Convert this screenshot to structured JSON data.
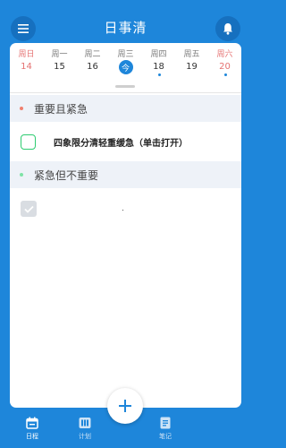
{
  "header": {
    "title": "日事清",
    "menu_icon": "menu-icon",
    "bell_icon": "bell-icon"
  },
  "week": [
    {
      "name": "周日",
      "date": "14",
      "weekend": true,
      "today": false,
      "has_event": false
    },
    {
      "name": "周一",
      "date": "15",
      "weekend": false,
      "today": false,
      "has_event": false
    },
    {
      "name": "周二",
      "date": "16",
      "weekend": false,
      "today": false,
      "has_event": false
    },
    {
      "name": "周三",
      "date": "今",
      "weekend": false,
      "today": true,
      "has_event": false
    },
    {
      "name": "周四",
      "date": "18",
      "weekend": false,
      "today": false,
      "has_event": true
    },
    {
      "name": "周五",
      "date": "19",
      "weekend": false,
      "today": false,
      "has_event": false
    },
    {
      "name": "周六",
      "date": "20",
      "weekend": true,
      "today": false,
      "has_event": true
    }
  ],
  "sections": [
    {
      "label": "重要且紧急",
      "color": "#f0806e"
    },
    {
      "label": "紧急但不重要",
      "color": "#7fe3a6"
    }
  ],
  "tasks": [
    {
      "text": "四象限分清轻重缓急（单击打开）",
      "checked": false
    },
    {
      "text": "",
      "checked": true
    }
  ],
  "fab": {
    "icon": "plus-icon"
  },
  "tabs": [
    {
      "label": "日程",
      "icon": "calendar-icon",
      "active": true
    },
    {
      "label": "计划",
      "icon": "board-icon",
      "active": false
    },
    {
      "label": "笔记",
      "icon": "note-icon",
      "active": false
    }
  ],
  "colors": {
    "primary": "#1e86da",
    "weekend": "#e57373",
    "section_bg": "#eef2f8",
    "checkbox_green": "#2ecc71"
  }
}
